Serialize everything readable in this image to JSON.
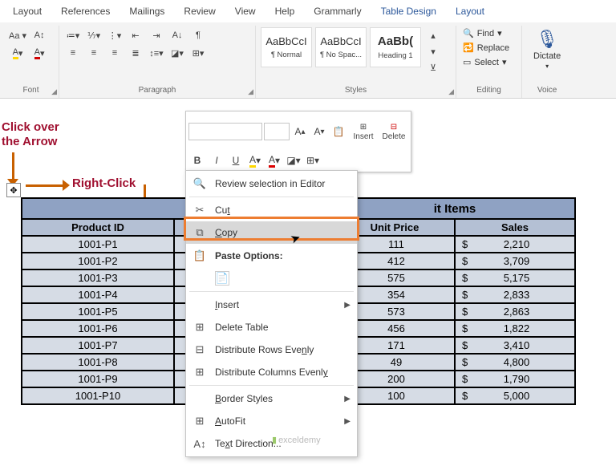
{
  "tabs": [
    "Layout",
    "References",
    "Mailings",
    "Review",
    "View",
    "Help",
    "Grammarly",
    "Table Design",
    "Layout"
  ],
  "activeTab": "Table Design",
  "groups": {
    "font": "Font",
    "paragraph": "Paragraph",
    "styles": "Styles",
    "editing": "Editing",
    "voice": "Voice"
  },
  "styles": [
    {
      "preview": "AaBbCcI",
      "name": "¶ Normal"
    },
    {
      "preview": "AaBbCcI",
      "name": "¶ No Spac..."
    },
    {
      "preview": "AaBb(",
      "name": "Heading 1"
    }
  ],
  "editing": {
    "find": "Find",
    "replace": "Replace",
    "select": "Select"
  },
  "voice": "Dictate",
  "annot": {
    "clickOver": "Click over",
    "theArrow": "the Arrow",
    "rightClick": "Right-Click"
  },
  "miniToolbar": {
    "insert": "Insert",
    "delete": "Delete",
    "bold": "B",
    "italic": "I"
  },
  "contextMenu": {
    "review": "Review selection in Editor",
    "cut": "Cut",
    "copy": "Copy",
    "pasteHeader": "Paste Options:",
    "insert": "Insert",
    "deleteTable": "Delete Table",
    "distRows": "Distribute Rows Evenly",
    "distCols": "Distribute Columns Evenly",
    "borderStyles": "Border Styles",
    "autofit": "AutoFit",
    "textDir": "Text Direction..."
  },
  "table": {
    "title": "it Items",
    "headers": [
      "Product ID",
      "Unit Price",
      "Sales"
    ],
    "rows": [
      {
        "id": "1001-P1",
        "price": "111",
        "sales": "2,210"
      },
      {
        "id": "1001-P2",
        "price": "412",
        "sales": "3,709"
      },
      {
        "id": "1001-P3",
        "price": "575",
        "sales": "5,175"
      },
      {
        "id": "1001-P4",
        "price": "354",
        "sales": "2,833"
      },
      {
        "id": "1001-P5",
        "price": "573",
        "sales": "2,863"
      },
      {
        "id": "1001-P6",
        "price": "456",
        "sales": "1,822"
      },
      {
        "id": "1001-P7",
        "price": "171",
        "sales": "3,410"
      },
      {
        "id": "1001-P8",
        "price": "49",
        "sales": "4,800"
      },
      {
        "id": "1001-P9",
        "price": "200",
        "sales": "1,790"
      },
      {
        "id": "1001-P10",
        "price": "100",
        "sales": "5,000"
      }
    ]
  },
  "watermark": "exceldemy"
}
